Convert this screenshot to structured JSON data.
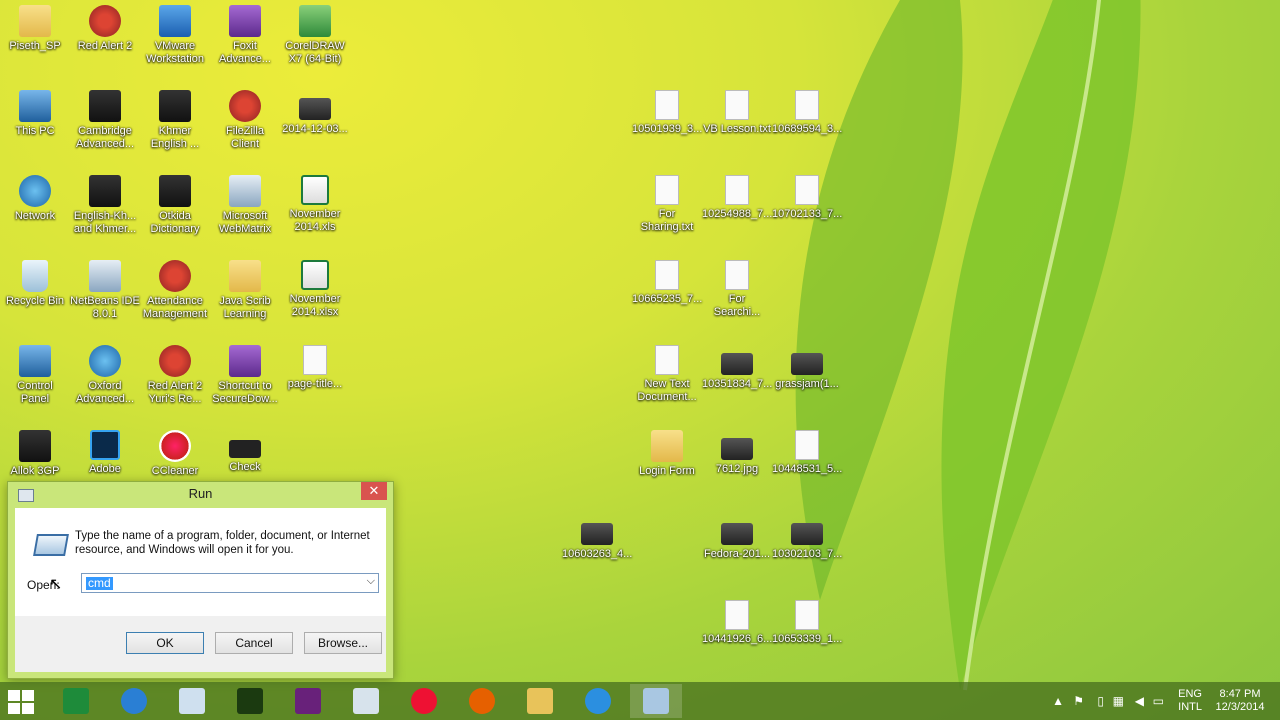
{
  "desktop_icons": [
    {
      "label": "Piseth_SP",
      "icon": "folder-icon"
    },
    {
      "label": "Red Alert 2",
      "icon": "red-alert-icon"
    },
    {
      "label": "VMware\nWorkstation",
      "icon": "vmware-icon"
    },
    {
      "label": "Foxit\nAdvance...",
      "icon": "foxit-icon"
    },
    {
      "label": "CorelDRAW\nX7 (64-Bit)",
      "icon": "coreldraw-icon"
    },
    {
      "label": "This PC",
      "icon": "this-pc-icon"
    },
    {
      "label": "Cambridge\nAdvanced...",
      "icon": "cambridge-icon"
    },
    {
      "label": "Khmer\nEnglish ...",
      "icon": "dictionary-icon"
    },
    {
      "label": "FileZilla\nClient",
      "icon": "filezilla-icon"
    },
    {
      "label": "2014-12-03...",
      "icon": "photo-icon"
    },
    {
      "label": "Network",
      "icon": "network-icon"
    },
    {
      "label": "English-Kh...\nand Khmer...",
      "icon": "dictionary-icon"
    },
    {
      "label": "Otkida\nDictionary",
      "icon": "book-icon"
    },
    {
      "label": "Microsoft\nWebMatrix",
      "icon": "webmatrix-icon"
    },
    {
      "label": "November\n2014.xls",
      "icon": "excel-icon"
    },
    {
      "label": "Recycle Bin",
      "icon": "recycle-bin-icon"
    },
    {
      "label": "NetBeans IDE\n8.0.1",
      "icon": "netbeans-icon"
    },
    {
      "label": "Attendance\nManagement",
      "icon": "attendance-icon"
    },
    {
      "label": "Java Scrib\nLearning",
      "icon": "folder-icon"
    },
    {
      "label": "November\n2014.xlsx",
      "icon": "excel-icon"
    },
    {
      "label": "Control\nPanel",
      "icon": "control-panel-icon"
    },
    {
      "label": "Oxford\nAdvanced...",
      "icon": "oxford-icon"
    },
    {
      "label": "Red Alert 2\nYuri's Re...",
      "icon": "red-alert-icon"
    },
    {
      "label": "Shortcut to\nSecureDow...",
      "icon": "shortcut-icon"
    },
    {
      "label": "page-title...",
      "icon": "file-icon"
    },
    {
      "label": "Allok 3GP",
      "icon": "clapper-icon"
    },
    {
      "label": "Adobe",
      "icon": "photoshop-icon"
    },
    {
      "label": "CCleaner",
      "icon": "ccleaner-icon"
    },
    {
      "label": "Check",
      "icon": "check-icon"
    },
    {
      "label": "10501939_3...",
      "icon": "document-icon"
    },
    {
      "label": "VB Lesson.txt",
      "icon": "document-icon"
    },
    {
      "label": "10689594_3...",
      "icon": "document-icon"
    },
    {
      "label": "For\nSharing.txt",
      "icon": "document-icon"
    },
    {
      "label": "10254988_7...",
      "icon": "document-icon"
    },
    {
      "label": "10702133_7...",
      "icon": "document-icon"
    },
    {
      "label": "10665235_7...",
      "icon": "document-icon"
    },
    {
      "label": "For\nSearchi...",
      "icon": "document-icon"
    },
    {
      "label": "New Text\nDocument...",
      "icon": "document-icon"
    },
    {
      "label": "10351834_7...",
      "icon": "photo-icon"
    },
    {
      "label": "grassjam(1...",
      "icon": "photo-icon"
    },
    {
      "label": "Login Form",
      "icon": "folder-icon"
    },
    {
      "label": "7612.jpg",
      "icon": "photo-icon"
    },
    {
      "label": "10448531_5...",
      "icon": "document-icon"
    },
    {
      "label": "10603263_4...",
      "icon": "photo-icon"
    },
    {
      "label": "Fedora-201...",
      "icon": "photo-icon"
    },
    {
      "label": "10302103_7...",
      "icon": "photo-icon"
    },
    {
      "label": "10441926_6...",
      "icon": "document-icon"
    },
    {
      "label": "10653339_1...",
      "icon": "document-icon"
    }
  ],
  "run_dialog": {
    "title": "Run",
    "close_label": "✕",
    "description": "Type the name of a program, folder, document, or Internet resource, and Windows will open it for you.",
    "open_label": "Open:",
    "input_value": "cmd",
    "ok_label": "OK",
    "cancel_label": "Cancel",
    "browse_label": "Browse..."
  },
  "taskbar": {
    "apps": [
      "store-icon",
      "chrome-icon",
      "virtualbox-icon",
      "dreamweaver-icon",
      "visual-studio-icon",
      "webmatrix-icon",
      "ccleaner-icon",
      "firefox-icon",
      "file-explorer-icon",
      "internet-explorer-icon",
      "run-icon"
    ],
    "language_top": "ENG",
    "language_bottom": "INTL",
    "time": "8:47 PM",
    "date": "12/3/2014"
  }
}
